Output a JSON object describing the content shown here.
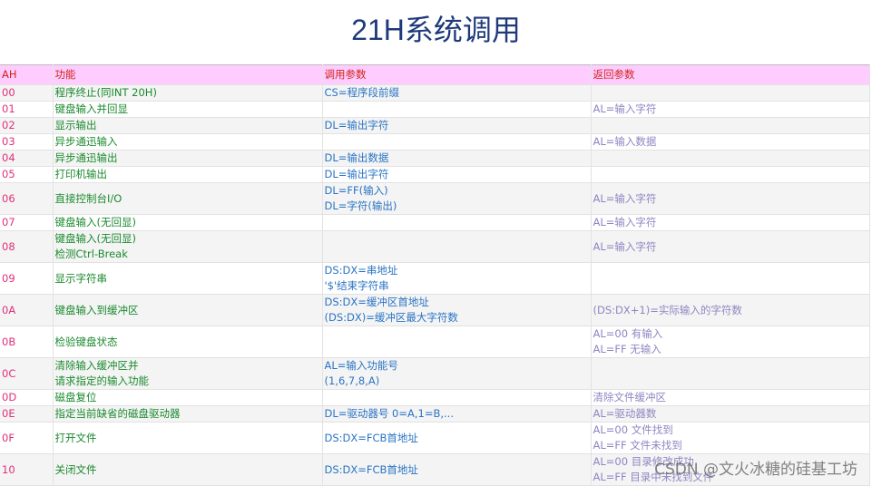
{
  "title": "21H系统调用",
  "headers": {
    "ah": "AH",
    "function": "功能",
    "params": "调用参数",
    "returns": "返回参数"
  },
  "rows": [
    {
      "ah": "00",
      "function": [
        "程序终止(同INT 20H)"
      ],
      "params": [
        "CS=程序段前缀"
      ],
      "returns": []
    },
    {
      "ah": "01",
      "function": [
        "键盘输入并回显"
      ],
      "params": [],
      "returns": [
        "AL=输入字符"
      ]
    },
    {
      "ah": "02",
      "function": [
        "显示输出"
      ],
      "params": [
        "DL=输出字符"
      ],
      "returns": []
    },
    {
      "ah": "03",
      "function": [
        "异步通迅输入"
      ],
      "params": [],
      "returns": [
        "AL=输入数据"
      ]
    },
    {
      "ah": "04",
      "function": [
        "异步通迅输出"
      ],
      "params": [
        "DL=输出数据"
      ],
      "returns": []
    },
    {
      "ah": "05",
      "function": [
        "打印机输出"
      ],
      "params": [
        "DL=输出字符"
      ],
      "returns": []
    },
    {
      "ah": "06",
      "function": [
        "直接控制台I/O"
      ],
      "params": [
        "DL=FF(输入)",
        "DL=字符(输出)"
      ],
      "returns": [
        "AL=输入字符"
      ]
    },
    {
      "ah": "07",
      "function": [
        "键盘输入(无回显)"
      ],
      "params": [],
      "returns": [
        "AL=输入字符"
      ]
    },
    {
      "ah": "08",
      "function": [
        "键盘输入(无回显)",
        "检测Ctrl-Break"
      ],
      "params": [],
      "returns": [
        "AL=输入字符"
      ]
    },
    {
      "ah": "09",
      "function": [
        "显示字符串"
      ],
      "params": [
        "DS:DX=串地址",
        "'$'结束字符串"
      ],
      "returns": []
    },
    {
      "ah": "0A",
      "function": [
        "键盘输入到缓冲区"
      ],
      "params": [
        "DS:DX=缓冲区首地址",
        "(DS:DX)=缓冲区最大字符数"
      ],
      "returns": [
        "(DS:DX+1)=实际输入的字符数"
      ]
    },
    {
      "ah": "0B",
      "function": [
        "检验键盘状态"
      ],
      "params": [],
      "returns": [
        "AL=00 有输入",
        "AL=FF 无输入"
      ]
    },
    {
      "ah": "0C",
      "function": [
        "清除输入缓冲区并",
        "请求指定的输入功能"
      ],
      "params": [
        "AL=输入功能号",
        "(1,6,7,8,A)"
      ],
      "returns": []
    },
    {
      "ah": "0D",
      "function": [
        "磁盘复位"
      ],
      "params": [],
      "returns": [
        "清除文件缓冲区"
      ]
    },
    {
      "ah": "0E",
      "function": [
        "指定当前缺省的磁盘驱动器"
      ],
      "params": [
        "DL=驱动器号 0=A,1=B,..."
      ],
      "returns": [
        "AL=驱动器数"
      ]
    },
    {
      "ah": "0F",
      "function": [
        "打开文件"
      ],
      "params": [
        "DS:DX=FCB首地址"
      ],
      "returns": [
        "AL=00 文件找到",
        "AL=FF 文件未找到"
      ]
    },
    {
      "ah": "10",
      "function": [
        "关闭文件"
      ],
      "params": [
        "DS:DX=FCB首地址"
      ],
      "returns": [
        "AL=00 目录修改成功",
        "AL=FF 目录中未找到文件"
      ]
    }
  ],
  "watermark": "CSDN @文火冰糖的硅基工坊"
}
